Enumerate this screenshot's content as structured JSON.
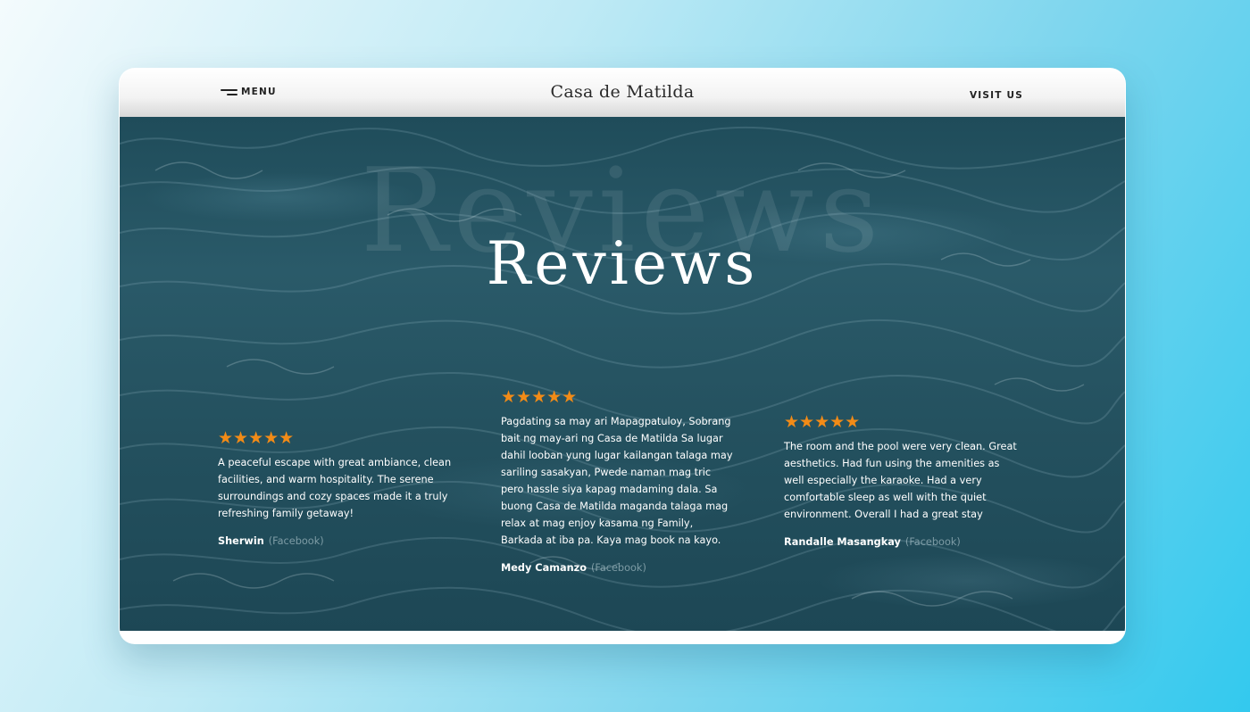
{
  "nav": {
    "menu_label": "MENU",
    "brand": "Casa de Matilda",
    "visit_label": "VISIT US"
  },
  "hero": {
    "ghost_title": "Reviews",
    "title": "Reviews"
  },
  "colors": {
    "star": "#f28b17",
    "water": "#24515f",
    "nav_bg": "#f3f3f3"
  },
  "reviews": [
    {
      "rating": 5,
      "stars": "★★★★★",
      "text": "A peaceful escape with great ambiance, clean facilities, and warm hospitality. The serene surroundings and cozy spaces made it a truly refreshing family getaway!",
      "author": "Sherwin",
      "source": "(Facebook)"
    },
    {
      "rating": 5,
      "stars": "★★★★★",
      "text": "Pagdating sa may ari Mapagpatuloy, Sobrang bait ng may-ari ng Casa de Matilda Sa lugar dahil looban yung lugar kailangan talaga may sariling sasakyan, Pwede naman mag tric pero hassle siya kapag madaming dala. Sa buong Casa de Matilda maganda talaga mag relax at mag enjoy kasama ng Family, Barkada at iba pa. Kaya mag book na kayo.",
      "author": "Medy Camanzo",
      "source": "(Facebook)"
    },
    {
      "rating": 5,
      "stars": "★★★★★",
      "text": "The room and the pool were very clean. Great aesthetics. Had fun using the amenities as well especially the karaoke. Had a very comfortable sleep as well with the quiet environment. Overall I had a great stay",
      "author": "Randalle Masangkay",
      "source": "(Facebook)"
    }
  ]
}
